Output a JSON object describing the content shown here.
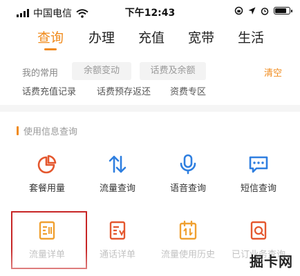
{
  "status_bar": {
    "carrier": "中国电信",
    "time": "下午12:43",
    "battery_level": 0.85
  },
  "tabs": [
    {
      "label": "查询",
      "active": true
    },
    {
      "label": "办理",
      "active": false
    },
    {
      "label": "充值",
      "active": false
    },
    {
      "label": "宽带",
      "active": false
    },
    {
      "label": "生活",
      "active": false
    }
  ],
  "favorites": {
    "label": "我的常用",
    "chips": [
      "余额变动",
      "话费及余额"
    ],
    "clear": "清空"
  },
  "links": [
    "话费充值记录",
    "话费预存返还",
    "资费专区"
  ],
  "section": {
    "title": "使用信息查询"
  },
  "grid": [
    {
      "label": "套餐用量",
      "icon": "pie-chart-icon"
    },
    {
      "label": "流量查询",
      "icon": "transfer-arrows-icon"
    },
    {
      "label": "语音查询",
      "icon": "microphone-icon"
    },
    {
      "label": "短信查询",
      "icon": "message-icon"
    },
    {
      "label": "流量详单",
      "icon": "data-detail-icon"
    },
    {
      "label": "通话详单",
      "icon": "call-detail-icon"
    },
    {
      "label": "流量使用历史",
      "icon": "data-history-icon"
    },
    {
      "label": "已订业务查询",
      "icon": "subscribed-service-icon"
    }
  ],
  "colors": {
    "accent": "#f08a1b",
    "icon_red": "#e4572e",
    "icon_blue": "#2f7fe0",
    "highlight": "#c72525"
  },
  "watermark": "掘卡网"
}
